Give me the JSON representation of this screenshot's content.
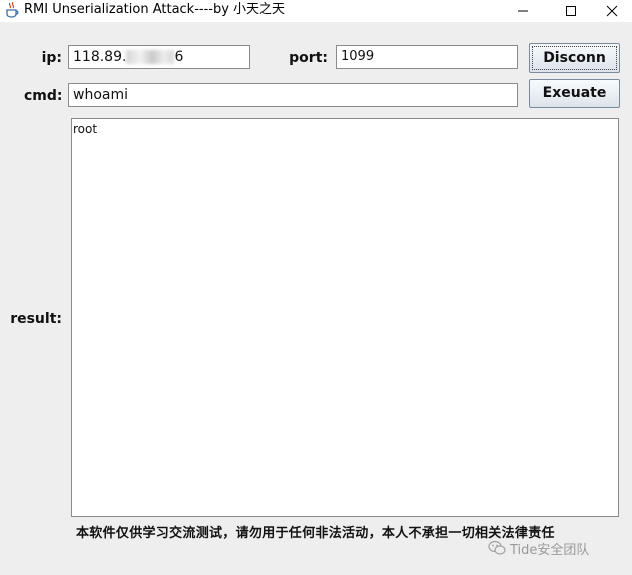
{
  "window": {
    "title": "RMI Unserialization Attack----by 小天之天",
    "controls": {
      "minimize": "minimize",
      "maximize": "maximize",
      "close": "close"
    }
  },
  "form": {
    "ip_label": "ip:",
    "ip_value_prefix": "118.89.",
    "ip_value_suffix": "6",
    "port_label": "port:",
    "port_value": "1099",
    "cmd_label": "cmd:",
    "cmd_value": "whoami",
    "result_label": "result:",
    "result_text": "root"
  },
  "buttons": {
    "connect_label": "Disconn",
    "execute_label": "Exeuate"
  },
  "footer": {
    "disclaimer": "本软件仅供学习交流测试，请勿用于任何非法活动，本人不承担一切相关法律责任",
    "watermark": "Tide安全团队"
  },
  "icons": {
    "app": "java-cup-icon",
    "watermark": "wechat-icon"
  }
}
